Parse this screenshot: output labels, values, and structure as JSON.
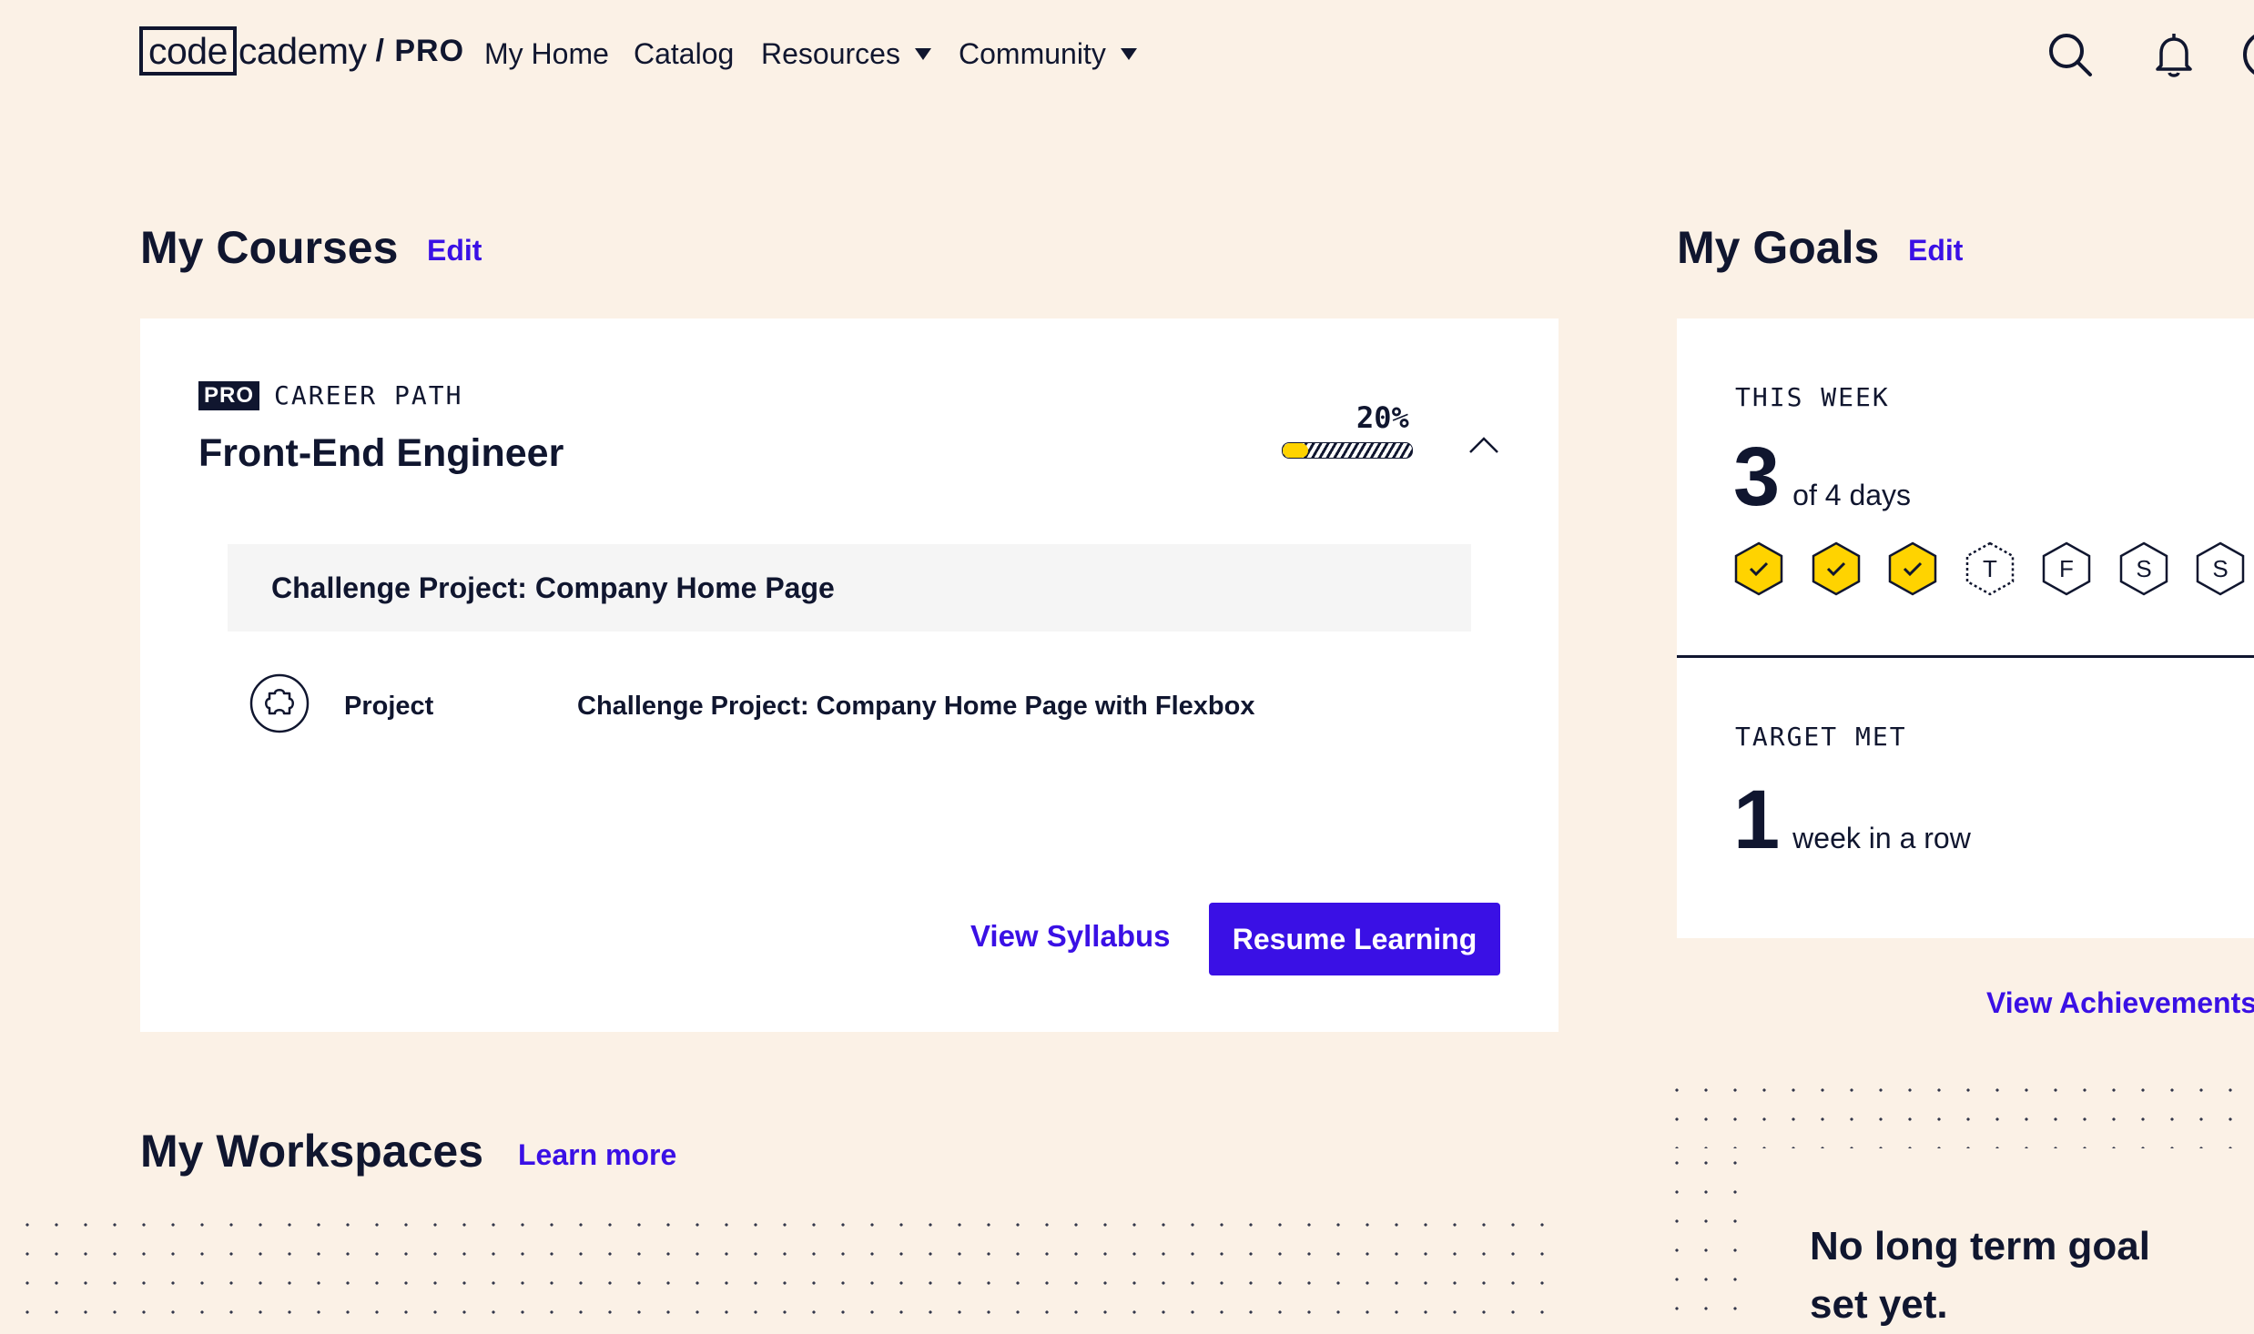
{
  "header": {
    "logo": {
      "part1": "code",
      "part2": "cademy",
      "tier": "/ PRO"
    },
    "nav": [
      {
        "label": "My Home",
        "has_dropdown": false
      },
      {
        "label": "Catalog",
        "has_dropdown": false
      },
      {
        "label": "Resources",
        "has_dropdown": true
      },
      {
        "label": "Community",
        "has_dropdown": true
      }
    ],
    "icons": [
      "search-icon",
      "bell-icon",
      "avatar"
    ]
  },
  "courses": {
    "title": "My Courses",
    "edit_label": "Edit",
    "card": {
      "badge": "PRO",
      "type": "CAREER PATH",
      "name": "Front-End Engineer",
      "progress_percent": 20,
      "progress_label": "20%",
      "current_module": "Challenge Project: Company Home Page",
      "item": {
        "icon": "puzzle-icon",
        "type": "Project",
        "title": "Challenge Project: Company Home Page with Flexbox"
      },
      "view_syllabus": "View Syllabus",
      "resume": "Resume Learning"
    }
  },
  "workspaces": {
    "title": "My Workspaces",
    "learn_more": "Learn more"
  },
  "goals": {
    "title": "My Goals",
    "edit_label": "Edit",
    "this_week": {
      "label": "THIS WEEK",
      "count": "3",
      "suffix": "of 4 days",
      "days": [
        {
          "letter": "",
          "done": true
        },
        {
          "letter": "",
          "done": true
        },
        {
          "letter": "",
          "done": true
        },
        {
          "letter": "T",
          "done": false,
          "today": true
        },
        {
          "letter": "F",
          "done": false
        },
        {
          "letter": "S",
          "done": false
        },
        {
          "letter": "S",
          "done": false
        }
      ]
    },
    "target_met": {
      "label": "TARGET MET",
      "count": "1",
      "suffix": "week in a row"
    },
    "view_achievements": "View Achievements",
    "long_term": "No long term goal set yet."
  },
  "colors": {
    "background": "#fbf1e6",
    "text": "#10162f",
    "accent": "#3a10e5",
    "progress": "#ffd300",
    "hex_done": "#ffd300"
  }
}
